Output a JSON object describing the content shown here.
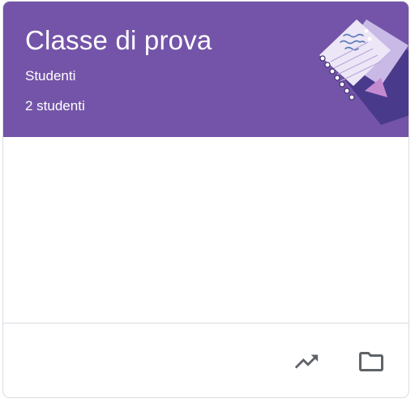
{
  "class_card": {
    "title": "Classe di prova",
    "section": "Studenti",
    "student_count": "2 studenti",
    "header_color": "#7454a8",
    "illustration": "notebook-illustration"
  },
  "footer": {
    "actions": [
      {
        "icon": "trending-up-icon"
      },
      {
        "icon": "folder-icon"
      }
    ]
  }
}
